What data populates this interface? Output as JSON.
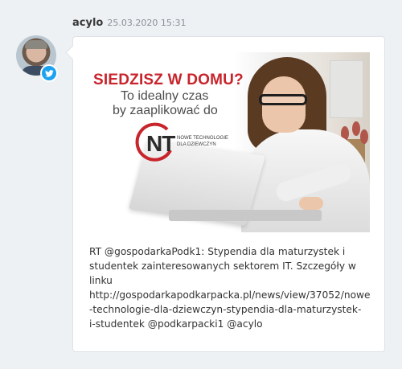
{
  "post": {
    "username": "acylo",
    "timestamp": "25.03.2020 15:31",
    "network_badge_icon": "twitter-bird-icon",
    "avatar_icon": "user-avatar",
    "image": {
      "headline_red": "SIEDZISZ W DOMU?",
      "headline_line2": "To idealny czas",
      "headline_line3": "by zaaplikować do",
      "logo_letters": "NT",
      "logo_text_line1": "NOWE TECHNOLOGIE",
      "logo_text_line2": "DLA DZIEWCZYN"
    },
    "text": "RT @gospodarkaPodk1: Stypendia dla maturzystek i\nstudentek zainteresowanych sektorem IT. Szczegóły w\nlinku\nhttp://gospodarkapodkarpacka.pl/news/view/37052/nowe\n-technologie-dla-dziewczyn-stypendia-dla-maturzystek-\ni-studentek @podkarpacki1 @acylo"
  },
  "colors": {
    "twitter_blue": "#1da1f2",
    "headline_red": "#c8242c",
    "page_background": "#eef1f4"
  }
}
